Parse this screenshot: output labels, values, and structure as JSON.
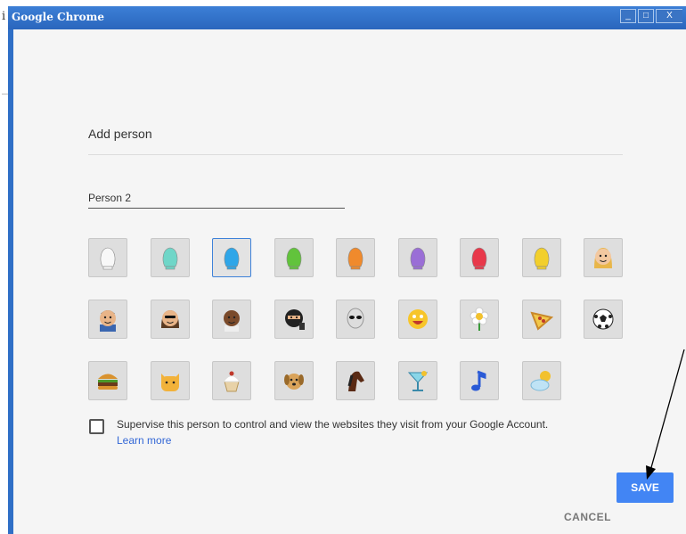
{
  "window": {
    "title": "Google Chrome",
    "minimize_label": "_",
    "maximize_label": "□",
    "close_label": "X"
  },
  "dialog": {
    "heading": "Add person",
    "name_value": "Person 2",
    "supervise_label": "Supervise this person to control and view the websites they visit from your Google Account.",
    "learn_more": "Learn more",
    "cancel_label": "CANCEL",
    "save_label": "SAVE"
  },
  "avatars": [
    {
      "icon": "white-head-icon"
    },
    {
      "icon": "teal-head-icon"
    },
    {
      "icon": "blue-head-icon",
      "selected": true
    },
    {
      "icon": "green-head-icon"
    },
    {
      "icon": "orange-head-icon"
    },
    {
      "icon": "purple-head-icon"
    },
    {
      "icon": "red-head-icon"
    },
    {
      "icon": "yellow-head-icon"
    },
    {
      "icon": "blonde-woman-icon"
    },
    {
      "icon": "businessman-icon"
    },
    {
      "icon": "woman-sunglasses-icon"
    },
    {
      "icon": "man-icon"
    },
    {
      "icon": "ninja-icon"
    },
    {
      "icon": "alien-icon"
    },
    {
      "icon": "smiley-face-icon"
    },
    {
      "icon": "flower-icon"
    },
    {
      "icon": "pizza-icon"
    },
    {
      "icon": "soccer-ball-icon"
    },
    {
      "icon": "hamburger-icon"
    },
    {
      "icon": "cat-icon"
    },
    {
      "icon": "cupcake-icon"
    },
    {
      "icon": "dog-icon"
    },
    {
      "icon": "horse-icon"
    },
    {
      "icon": "cocktail-icon"
    },
    {
      "icon": "music-note-icon"
    },
    {
      "icon": "sun-cloud-icon"
    }
  ]
}
